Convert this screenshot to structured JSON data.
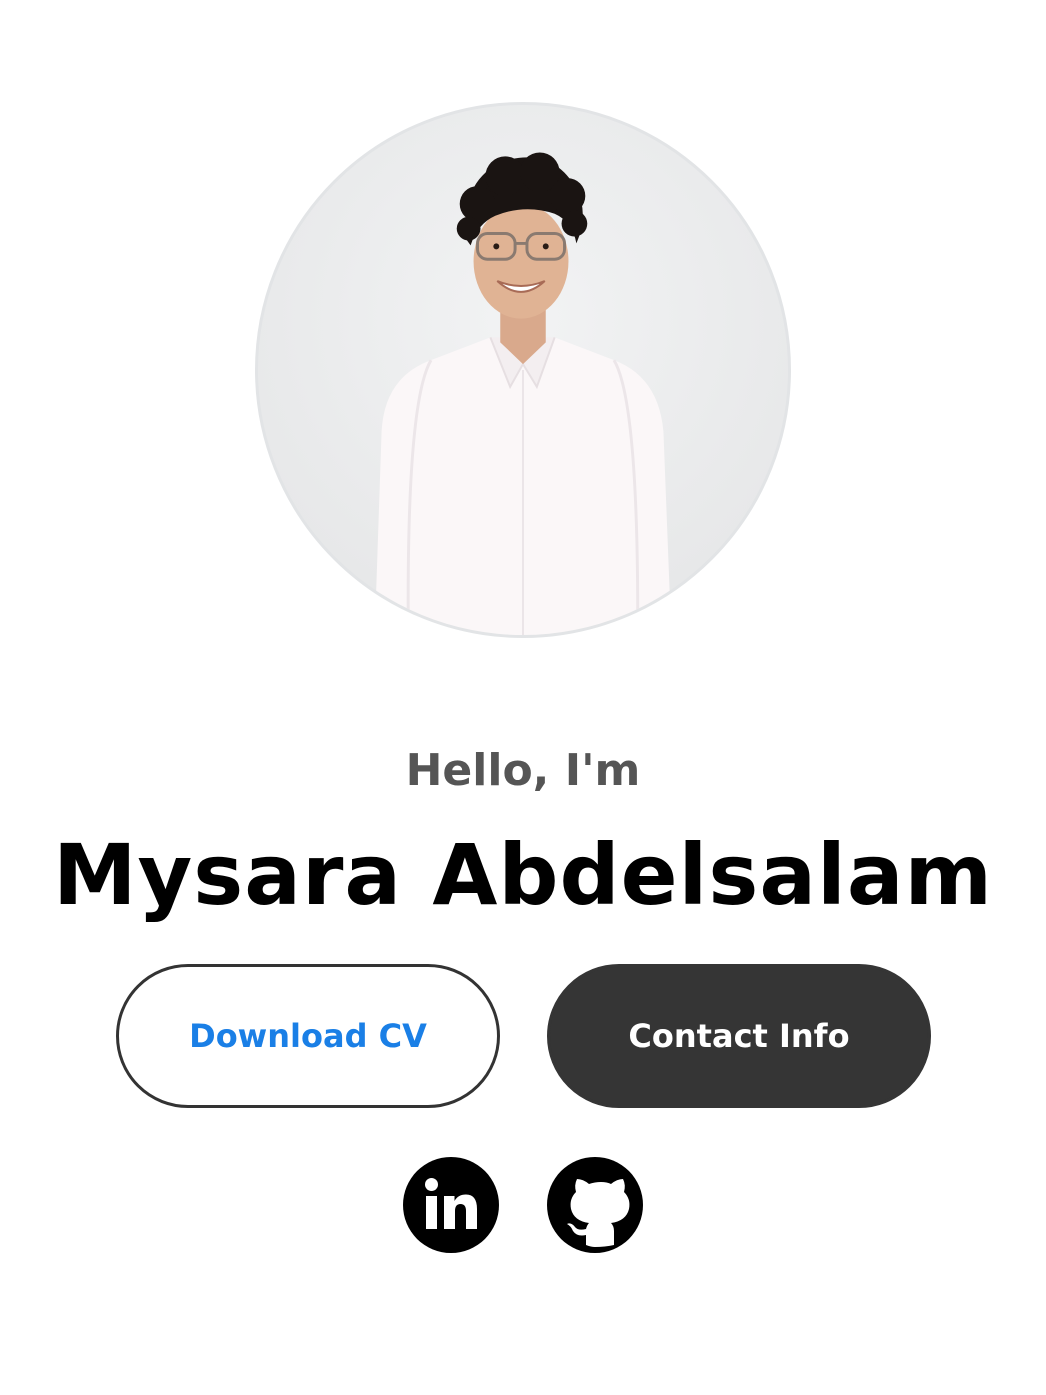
{
  "hero": {
    "greeting": "Hello, I'm",
    "name": "Mysara Abdelsalam",
    "profile_image_alt": "Mysara Abdelsalam profile picture"
  },
  "actions": {
    "download_cv_label": "Download CV",
    "contact_info_label": "Contact Info"
  },
  "socials": [
    {
      "icon": "linkedin-icon",
      "label": "LinkedIn"
    },
    {
      "icon": "github-icon",
      "label": "GitHub"
    }
  ],
  "colors": {
    "accent": "#1a7fe6",
    "dark_button": "#353535",
    "greeting_text": "#555555",
    "name_text": "#000000"
  }
}
